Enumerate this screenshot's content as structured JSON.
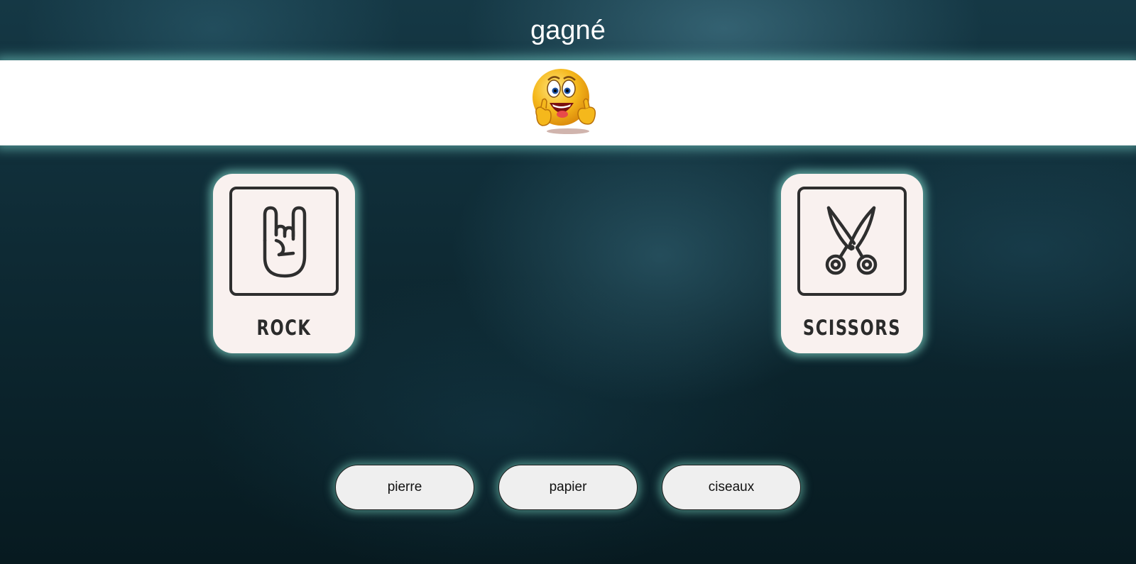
{
  "result": {
    "title": "gagné",
    "emoji": "laughing-thumbs-up-emoji"
  },
  "player_card": {
    "label": "ROCK",
    "icon": "rock-hand-icon"
  },
  "computer_card": {
    "label": "SCISSORS",
    "icon": "scissors-icon"
  },
  "choices": [
    {
      "label": "pierre"
    },
    {
      "label": "papier"
    },
    {
      "label": "ciseaux"
    }
  ],
  "colors": {
    "glow": "#82dccd",
    "card_bg": "#f9f1ef",
    "button_bg": "#efefef",
    "title_text": "#ffffff"
  }
}
